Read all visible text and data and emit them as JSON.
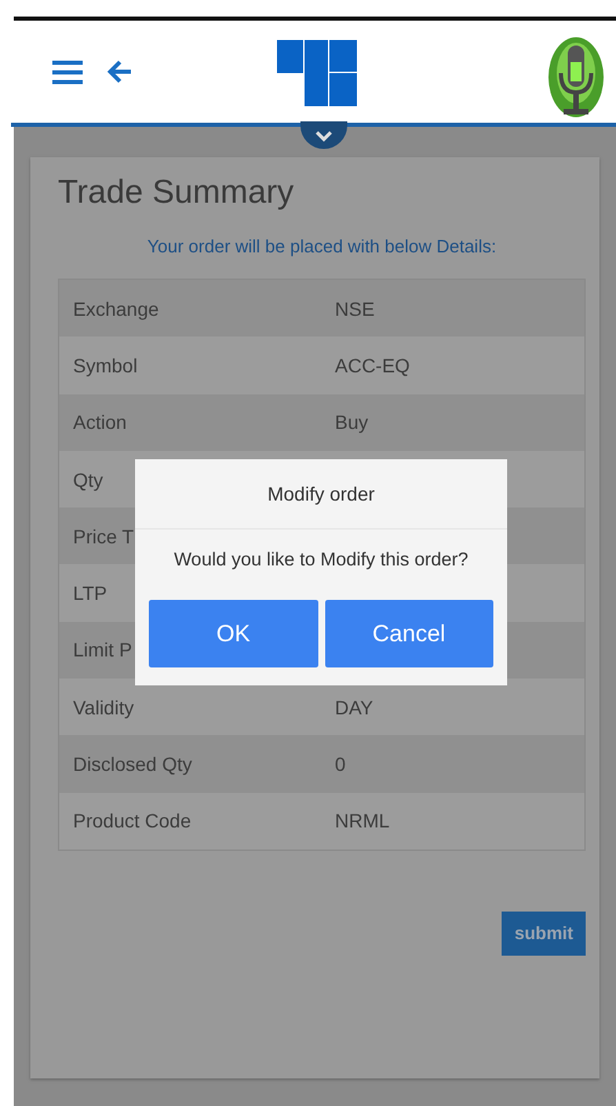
{
  "page": {
    "title": "Trade Summary",
    "subtitle": "Your order will be placed with below Details:"
  },
  "details": [
    {
      "label": "Exchange",
      "value": "NSE"
    },
    {
      "label": "Symbol",
      "value": "ACC-EQ"
    },
    {
      "label": "Action",
      "value": "Buy"
    },
    {
      "label": "Qty"
    },
    {
      "label": "Price T"
    },
    {
      "label": "LTP"
    },
    {
      "label": "Limit P"
    },
    {
      "label": "Validity",
      "value": "DAY"
    },
    {
      "label": "Disclosed Qty",
      "value": "0"
    },
    {
      "label": "Product Code",
      "value": "NRML"
    }
  ],
  "submit_button": "submit",
  "dialog": {
    "title": "Modify order",
    "message": "Would you like to Modify this order?",
    "buttons": [
      "OK",
      "Cancel"
    ]
  }
}
